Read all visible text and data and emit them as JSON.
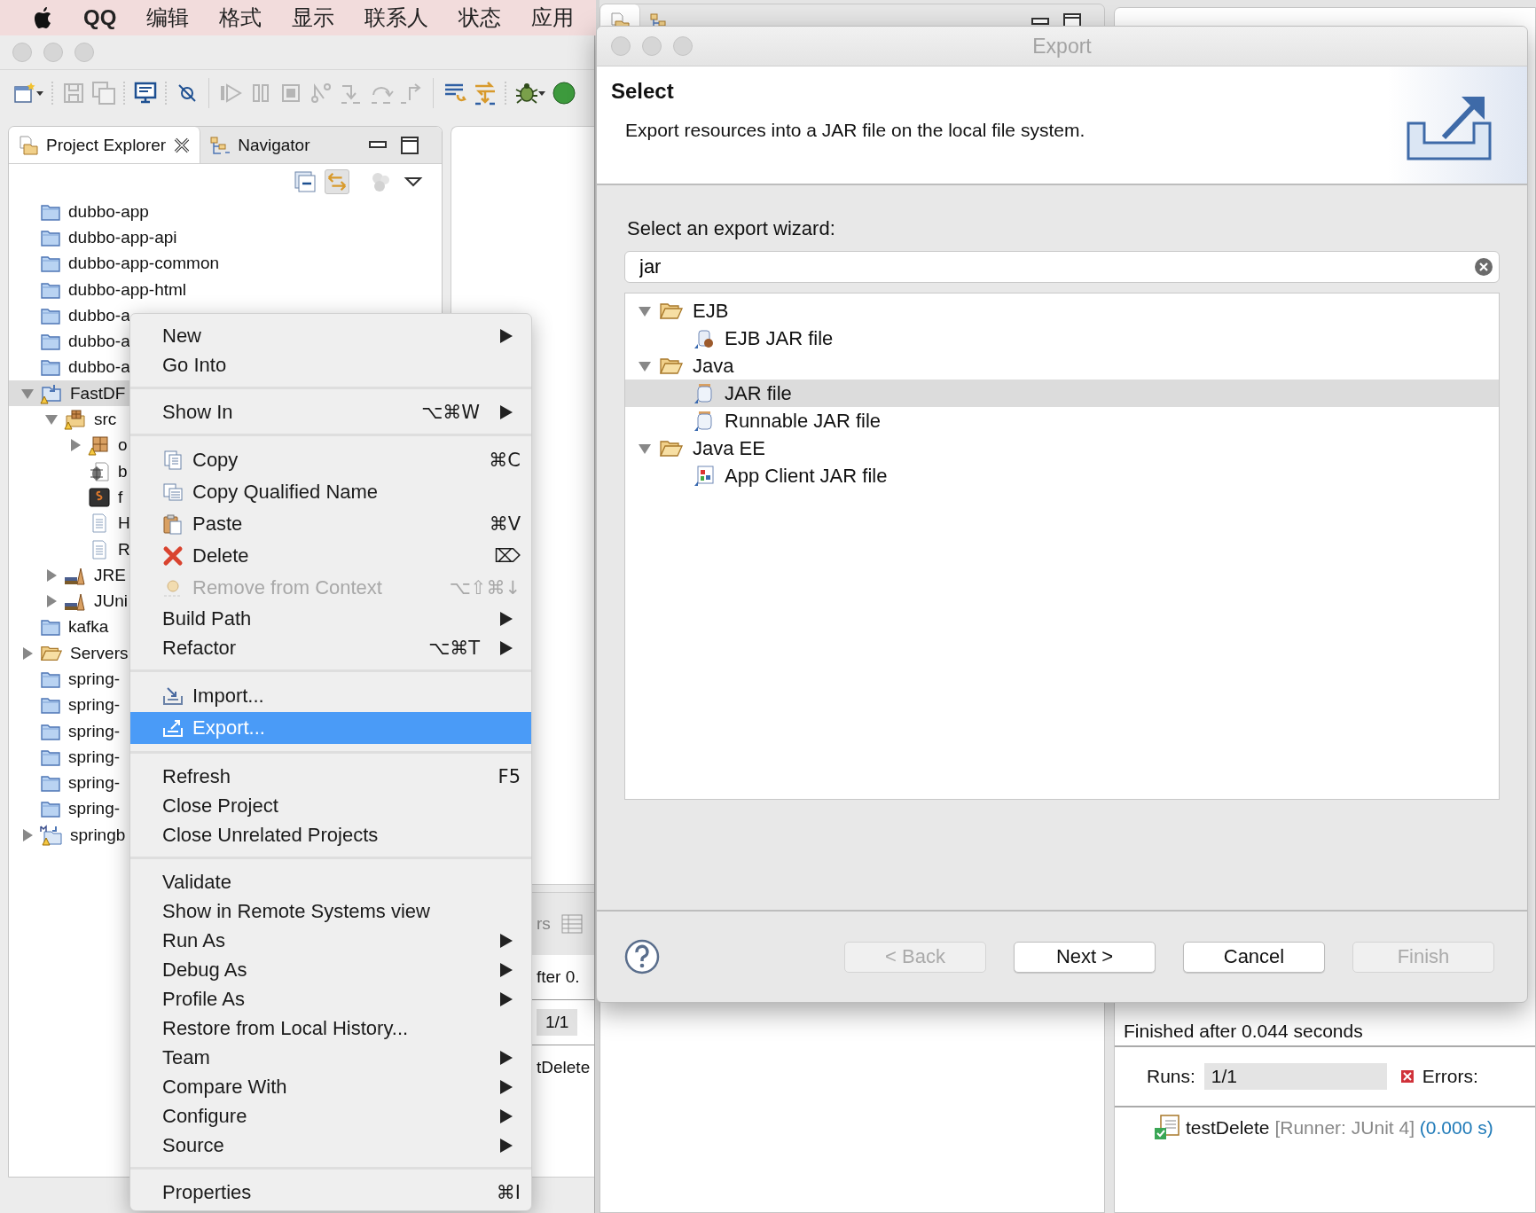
{
  "menubar": {
    "app": "QQ",
    "menus": [
      "编辑",
      "格式",
      "显示",
      "联系人",
      "状态",
      "应用"
    ]
  },
  "ide": {
    "tabs": [
      {
        "label": "Project Explorer",
        "selected": true
      },
      {
        "label": "Navigator",
        "selected": false
      }
    ],
    "tree": [
      {
        "label": "dubbo-app",
        "kind": "project",
        "selected": false
      },
      {
        "label": "dubbo-app-api",
        "kind": "project",
        "selected": false
      },
      {
        "label": "dubbo-app-common",
        "kind": "project",
        "selected": false
      },
      {
        "label": "dubbo-app-html",
        "kind": "project",
        "selected": false
      },
      {
        "label": "dubbo-a",
        "kind": "project",
        "selected": false
      },
      {
        "label": "dubbo-a",
        "kind": "project",
        "selected": false
      },
      {
        "label": "dubbo-a",
        "kind": "project",
        "selected": false
      },
      {
        "label": "FastDF",
        "kind": "web",
        "selected": true,
        "expanded": true,
        "children": [
          {
            "label": "src",
            "kind": "source",
            "selected": false,
            "expanded": true,
            "children": [
              {
                "label": "o",
                "kind": "package",
                "selected": false,
                "expanded": false
              },
              {
                "label": "b",
                "kind": "script",
                "selected": false
              },
              {
                "label": "f",
                "kind": "terminal",
                "selected": false
              },
              {
                "label": "H",
                "kind": "text",
                "selected": false
              },
              {
                "label": "R",
                "kind": "text",
                "selected": false
              }
            ]
          },
          {
            "label": "JRE",
            "kind": "library",
            "selected": false,
            "expanded": false
          },
          {
            "label": "JUni",
            "kind": "library",
            "selected": false,
            "expanded": false
          }
        ]
      },
      {
        "label": "kafka",
        "kind": "project",
        "selected": false
      },
      {
        "label": "Servers",
        "kind": "folder",
        "selected": false,
        "expanded": false
      },
      {
        "label": "spring-",
        "kind": "project",
        "selected": false
      },
      {
        "label": "spring-",
        "kind": "project",
        "selected": false
      },
      {
        "label": "spring-",
        "kind": "project",
        "selected": false
      },
      {
        "label": "spring-",
        "kind": "project",
        "selected": false
      },
      {
        "label": "spring-",
        "kind": "project",
        "selected": false
      },
      {
        "label": "spring-",
        "kind": "project",
        "selected": false
      },
      {
        "label": "springb",
        "kind": "maven",
        "selected": false,
        "expanded": false
      }
    ],
    "bottom": {
      "tab": "rs",
      "summary": "fter 0.",
      "runs": "1/1",
      "test": "tDelete"
    }
  },
  "context_menu": {
    "groups": [
      [
        {
          "label": "New",
          "submenu": true,
          "disabled": false,
          "selected": false
        },
        {
          "label": "Go Into",
          "submenu": false,
          "disabled": false,
          "selected": false
        }
      ],
      [
        {
          "label": "Show In",
          "shortcut": "⌥⌘W",
          "submenu": true,
          "disabled": false,
          "selected": false
        }
      ],
      [
        {
          "label": "Copy",
          "shortcut": "⌘C",
          "submenu": false,
          "disabled": false,
          "selected": false
        },
        {
          "label": "Copy Qualified Name",
          "submenu": false,
          "disabled": false,
          "selected": false
        },
        {
          "label": "Paste",
          "shortcut": "⌘V",
          "submenu": false,
          "disabled": false,
          "selected": false
        },
        {
          "label": "Delete",
          "shortcut": "⌦",
          "submenu": false,
          "disabled": false,
          "selected": false
        },
        {
          "label": "Remove from Context",
          "shortcut": "⌥⇧⌘↓",
          "submenu": false,
          "disabled": true,
          "selected": false
        },
        {
          "label": "Build Path",
          "submenu": true,
          "disabled": false,
          "selected": false
        },
        {
          "label": "Refactor",
          "shortcut": "⌥⌘T",
          "submenu": true,
          "disabled": false,
          "selected": false
        }
      ],
      [
        {
          "label": "Import...",
          "submenu": false,
          "disabled": false,
          "selected": false
        },
        {
          "label": "Export...",
          "submenu": false,
          "disabled": false,
          "selected": true
        }
      ],
      [
        {
          "label": "Refresh",
          "shortcut": "F5",
          "submenu": false,
          "disabled": false,
          "selected": false
        },
        {
          "label": "Close Project",
          "submenu": false,
          "disabled": false,
          "selected": false
        },
        {
          "label": "Close Unrelated Projects",
          "submenu": false,
          "disabled": false,
          "selected": false
        }
      ],
      [
        {
          "label": "Validate",
          "submenu": false,
          "disabled": false,
          "selected": false
        },
        {
          "label": "Show in Remote Systems view",
          "submenu": false,
          "disabled": false,
          "selected": false
        },
        {
          "label": "Run As",
          "submenu": true,
          "disabled": false,
          "selected": false
        },
        {
          "label": "Debug As",
          "submenu": true,
          "disabled": false,
          "selected": false
        },
        {
          "label": "Profile As",
          "submenu": true,
          "disabled": false,
          "selected": false
        },
        {
          "label": "Restore from Local History...",
          "submenu": false,
          "disabled": false,
          "selected": false
        },
        {
          "label": "Team",
          "submenu": true,
          "disabled": false,
          "selected": false
        },
        {
          "label": "Compare With",
          "submenu": true,
          "disabled": false,
          "selected": false
        },
        {
          "label": "Configure",
          "submenu": true,
          "disabled": false,
          "selected": false
        },
        {
          "label": "Source",
          "submenu": true,
          "disabled": false,
          "selected": false
        }
      ],
      [
        {
          "label": "Properties",
          "shortcut": "⌘I",
          "submenu": false,
          "disabled": false,
          "selected": false
        }
      ]
    ]
  },
  "behind": {
    "junit": {
      "summary": "Finished after 0.044 seconds",
      "runs_label": "Runs:",
      "runs": "1/1",
      "errors_label": "Errors:",
      "test": {
        "name": "testDelete",
        "runner": "[Runner: JUnit 4]",
        "time": "(0.000 s)"
      }
    }
  },
  "dialog": {
    "title": "Export",
    "heading": "Select",
    "description": "Export resources into a JAR file on the local file system.",
    "prompt": "Select an export wizard:",
    "search": {
      "value": "jar"
    },
    "tree": [
      {
        "label": "EJB",
        "kind": "category",
        "expanded": true,
        "selected": false,
        "children": [
          {
            "label": "EJB JAR file",
            "kind": "ejb",
            "selected": false
          }
        ]
      },
      {
        "label": "Java",
        "kind": "category",
        "expanded": true,
        "selected": false,
        "children": [
          {
            "label": "JAR file",
            "kind": "jar",
            "selected": true
          },
          {
            "label": "Runnable JAR file",
            "kind": "jar",
            "selected": false
          }
        ]
      },
      {
        "label": "Java EE",
        "kind": "category",
        "expanded": true,
        "selected": false,
        "children": [
          {
            "label": "App Client JAR file",
            "kind": "client",
            "selected": false
          }
        ]
      }
    ],
    "buttons": [
      {
        "label": "< Back",
        "disabled": true
      },
      {
        "label": "Next >",
        "disabled": false
      },
      {
        "label": "Cancel",
        "disabled": false
      },
      {
        "label": "Finish",
        "disabled": true
      }
    ]
  }
}
